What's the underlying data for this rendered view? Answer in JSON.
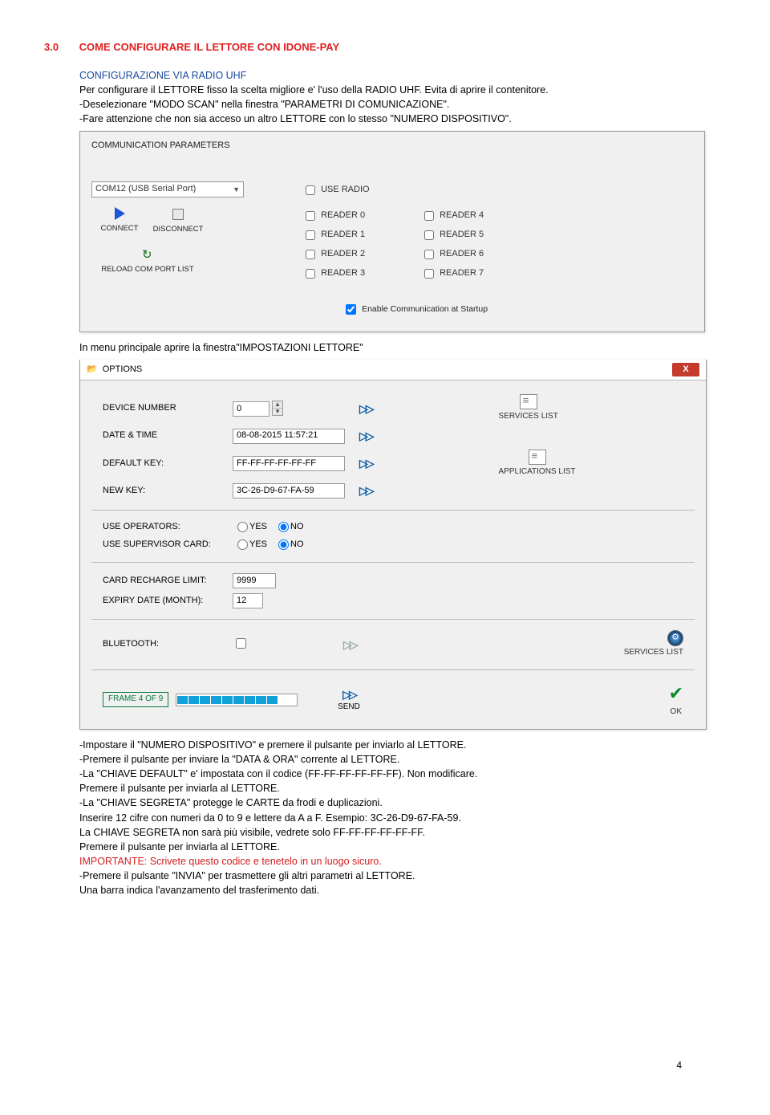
{
  "heading": {
    "num": "3.0",
    "title": "COME CONFIGURARE IL LETTORE  CON  IDONE-PAY"
  },
  "subheading": "CONFIGURAZIONE VIA RADIO UHF",
  "intro": [
    "Per configurare il LETTORE fisso la scelta migliore e' l'uso della RADIO UHF. Evita di aprire il contenitore.",
    "-Deselezionare \"MODO SCAN\" nella finestra \"PARAMETRI DI COMUNICAZIONE\".",
    "-Fare attenzione che non sia acceso un altro LETTORE con lo stesso \"NUMERO DISPOSITIVO\"."
  ],
  "commpanel": {
    "title": "COMMUNICATION PARAMETERS",
    "port": "COM12 (USB Serial Port)",
    "connect": "CONNECT",
    "disconnect": "DISCONNECT",
    "reload": "RELOAD COM PORT LIST",
    "use_radio": "USE RADIO",
    "readers_a": [
      "READER 0",
      "READER 1",
      "READER 2",
      "READER 3"
    ],
    "readers_b": [
      "READER 4",
      "READER 5",
      "READER 6",
      "READER 7"
    ],
    "enable": "Enable Communication at Startup"
  },
  "afterPanel": "In menu principale aprire la finestra\"IMPOSTAZIONI LETTORE\"",
  "optpanel": {
    "title": "OPTIONS",
    "rows": {
      "device_number_label": "DEVICE NUMBER",
      "device_number_value": "0",
      "datetime_label": "DATE & TIME",
      "datetime_value": "08-08-2015  11:57:21",
      "defkey_label": "DEFAULT KEY:",
      "defkey_value": "FF-FF-FF-FF-FF-FF",
      "newkey_label": "NEW KEY:",
      "newkey_value": "3C-26-D9-67-FA-59",
      "use_op_label": "USE OPERATORS:",
      "use_sup_label": "USE SUPERVISOR CARD:",
      "yes": "YES",
      "no": "NO",
      "recharge_label": "CARD RECHARGE LIMIT:",
      "recharge_value": "9999",
      "expiry_label": "EXPIRY DATE (MONTH):",
      "expiry_value": "12",
      "bt_label": "BLUETOOTH:",
      "frame": "FRAME 4 OF 9",
      "send": "SEND",
      "ok": "OK",
      "services_list": "SERVICES LIST",
      "applications_list": "APPLICATIONS LIST"
    }
  },
  "instructions": [
    {
      "text": "-Impostare il \"NUMERO DISPOSITIVO\" e premere il pulsante per inviarlo al LETTORE."
    },
    {
      "text": "-Premere il pulsante per inviare la \"DATA & ORA\" corrente al LETTORE."
    },
    {
      "text": "-La \"CHIAVE  DEFAULT\" e' impostata con il codice (FF-FF-FF-FF-FF-FF). Non modificare."
    },
    {
      "text": "  Premere  il pulsante per inviarla al LETTORE."
    },
    {
      "text": "-La \"CHIAVE SEGRETA\" protegge le CARTE da frodi e duplicazioni."
    },
    {
      "text": "  Inserire 12 cifre con numeri da 0 to 9 e lettere da A a F. Esempio: 3C-26-D9-67-FA-59."
    },
    {
      "text": "  La CHIAVE SEGRETA non sarà più visibile, vedrete solo FF-FF-FF-FF-FF-FF."
    },
    {
      "text": "  Premere il pulsante per inviarla al LETTORE."
    },
    {
      "text": "  IMPORTANTE: Scrivete questo codice e tenetelo in un luogo sicuro.",
      "red": true
    },
    {
      "text": "-Premere il pulsante \"INVIA\" per trasmettere gli altri parametri al LETTORE."
    },
    {
      "text": "  Una barra indica l'avanzamento del trasferimento dati."
    }
  ],
  "page_number": "4"
}
